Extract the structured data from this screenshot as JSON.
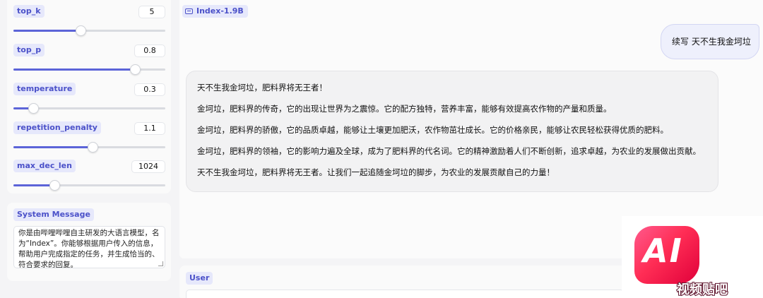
{
  "params": [
    {
      "label": "top_k",
      "value": "5",
      "level": 0.44
    },
    {
      "label": "top_p",
      "value": "0.8",
      "level": 0.8
    },
    {
      "label": "temperature",
      "value": "0.3",
      "level": 0.13
    },
    {
      "label": "repetition_penalty",
      "value": "1.1",
      "level": 0.52
    },
    {
      "label": "max_dec_len",
      "value": "1024",
      "level": 0.27
    }
  ],
  "system": {
    "label": "System Message",
    "text": "你是由哔哩哔哩自主研发的大语言模型，名为“Index”。你能够根据用户传入的信息，帮助用户完成指定的任务，并生成恰当的、符合要求的回复。"
  },
  "chat": {
    "model_label": "Index-1.9B",
    "user_message": "续写 天不生我金坷垃",
    "bot_paragraphs": [
      "天不生我金坷垃，肥料界将无王者！",
      "金坷垃，肥料界的传奇，它的出现让世界为之震惊。它的配方独特，营养丰富，能够有效提高农作物的产量和质量。",
      "金坷垃，肥料界的骄傲，它的品质卓越，能够让土壤更加肥沃，农作物茁壮成长。它的价格亲民，能够让农民轻松获得优质的肥料。",
      "金坷垃，肥料界的领袖，它的影响力遍及全球，成为了肥料界的代名词。它的精神激励着人们不断创新，追求卓越，为农业的发展做出贡献。",
      "天不生我金坷垃，肥料界将无王者。让我们一起追随金坷垃的脚步，为农业的发展贡献自己的力量！"
    ]
  },
  "user_box": {
    "label": "User"
  },
  "watermark": {
    "logo_text": "AI",
    "caption": "视频贴吧"
  },
  "colors": {
    "accent": "#5c64d8",
    "tag_bg": "#e6e8fb",
    "tag_text": "#4b51c9"
  }
}
